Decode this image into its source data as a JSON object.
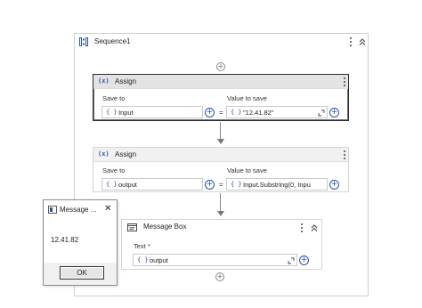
{
  "sequence": {
    "title": "Sequence1"
  },
  "assign1": {
    "title": "Assign",
    "icon": "(x)",
    "save_to_label": "Save to",
    "value_label": "Value to save",
    "save_to_value": "Input",
    "value": "\"12.41.82\"",
    "eq": "="
  },
  "assign2": {
    "title": "Assign",
    "icon": "(x)",
    "save_to_label": "Save to",
    "value_label": "Value to save",
    "save_to_value": "output",
    "value": "Input.Substring(0, Inpu",
    "eq": "="
  },
  "message_box": {
    "title": "Message Box",
    "text_label": "Text *",
    "text_value": "output"
  },
  "dialog": {
    "title": "Message ...",
    "message": "12.41.82",
    "ok_label": "OK",
    "close_glyph": "✕"
  },
  "glyphs": {
    "brace": "{ }",
    "plus": "+"
  }
}
